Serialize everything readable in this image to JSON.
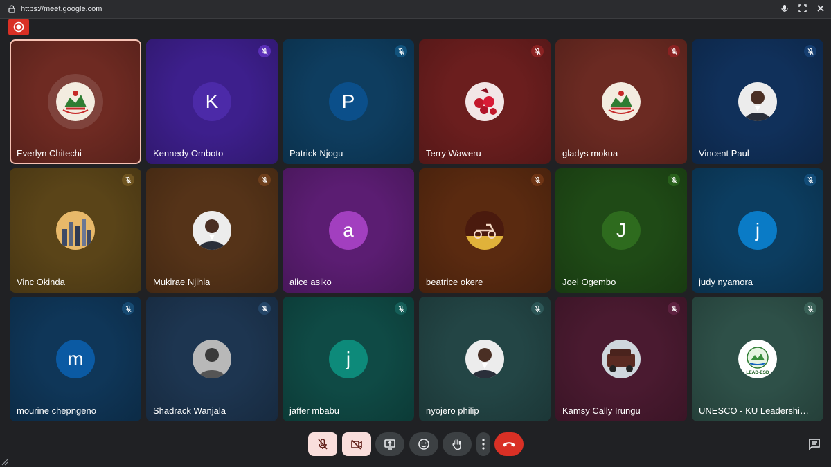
{
  "browser": {
    "url": "https://meet.google.com"
  },
  "participants": [
    {
      "name": "Everlyn Chitechi",
      "avatar": "emblem",
      "bg": "#6e2a22",
      "micColor": "",
      "active": true
    },
    {
      "name": "Kennedy Omboto",
      "avatar": "K",
      "avatarColor": "#4c2aa8",
      "bg": "#3d1f8c",
      "micColor": "#5a2fb8"
    },
    {
      "name": "Patrick Njogu",
      "avatar": "P",
      "avatarColor": "#0b4f8a",
      "bg": "#0e3d5f",
      "micColor": "#12537d"
    },
    {
      "name": "Terry Waweru",
      "avatar": "roses-photo",
      "bg": "#6b1e1e",
      "micColor": "#8a2222"
    },
    {
      "name": "gladys mokua",
      "avatar": "emblem",
      "bg": "#6b2a22",
      "micColor": "#8a2222"
    },
    {
      "name": "Vincent Paul",
      "avatar": "man-photo",
      "bg": "#10305a",
      "micColor": "#163e70"
    },
    {
      "name": "Vinc Okinda",
      "avatar": "city-photo",
      "bg": "#5a4418",
      "micColor": "#6e5420"
    },
    {
      "name": "Mukirae Njihia",
      "avatar": "man-photo",
      "bg": "#553318",
      "micColor": "#6e3f1c"
    },
    {
      "name": "alice asiko",
      "avatar": "a",
      "avatarColor": "#a23fbf",
      "bg": "#5b1d72",
      "micColor": ""
    },
    {
      "name": "beatrice okere",
      "avatar": "scooter-photo",
      "bg": "#5a2a10",
      "micColor": "#6e3414"
    },
    {
      "name": "Joel Ogembo",
      "avatar": "J",
      "avatarColor": "#2e6b1e",
      "bg": "#1f4a16",
      "micColor": "#28601b"
    },
    {
      "name": "judy nyamora",
      "avatar": "j",
      "avatarColor": "#0a7bc6",
      "bg": "#0c3d60",
      "micColor": "#124c78"
    },
    {
      "name": "mourine chepngeno",
      "avatar": "m",
      "avatarColor": "#0b5aa3",
      "bg": "#0f3658",
      "micColor": "#164a72"
    },
    {
      "name": "Shadrack Wanjala",
      "avatar": "man-photo-bw",
      "bg": "#1d3550",
      "micColor": "#254668"
    },
    {
      "name": "jaffer mbabu",
      "avatar": "j",
      "avatarColor": "#0d8a7a",
      "bg": "#0f4a45",
      "micColor": "#155e58"
    },
    {
      "name": "nyojero philip",
      "avatar": "man-photo",
      "bg": "#234545",
      "micColor": "#2c5656"
    },
    {
      "name": "Kamsy Cally Irungu",
      "avatar": "car-photo",
      "bg": "#4a1a30",
      "micColor": "#5e2240"
    },
    {
      "name": "UNESCO - KU Leadership ...",
      "avatar": "lead-esd",
      "bg": "#2e5048",
      "micColor": "#3a6258"
    }
  ],
  "controls": {
    "mic": "mic-off-icon",
    "camera": "camera-off-icon",
    "present": "present-icon",
    "reactions": "emoji-icon",
    "hand": "raise-hand-icon",
    "more": "more-vert-icon",
    "leave": "end-call-icon",
    "chat": "chat-icon"
  },
  "lead_logo_text": "LEAD-ESD"
}
